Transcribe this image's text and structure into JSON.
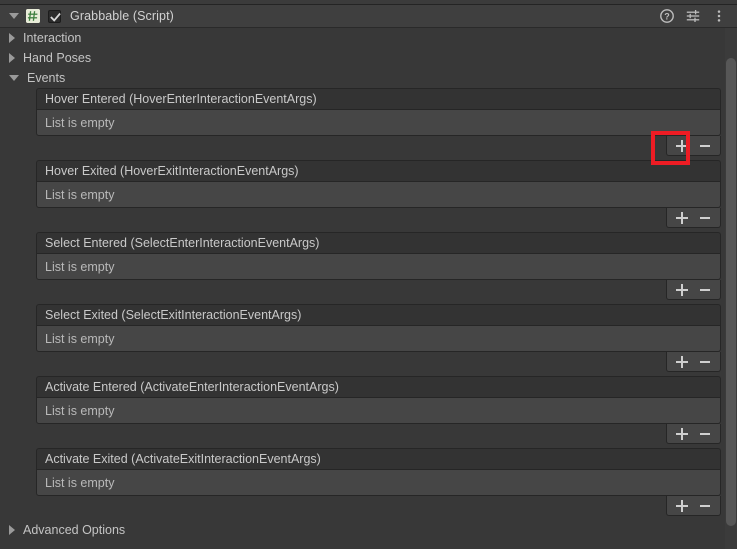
{
  "component": {
    "title": "Grabbable (Script)",
    "enabled": true,
    "expanded": true,
    "script_icon": "csharp-script-icon",
    "header_icons": [
      {
        "name": "help-icon",
        "glyph": "?"
      },
      {
        "name": "preset-icon",
        "glyph": "sliders"
      },
      {
        "name": "more-menu-icon",
        "glyph": "kebab"
      }
    ]
  },
  "properties": [
    {
      "label": "Interaction",
      "expanded": false
    },
    {
      "label": "Hand Poses",
      "expanded": false
    },
    {
      "label": "Events",
      "expanded": true
    }
  ],
  "events": [
    {
      "header": "Hover Entered (HoverEnterInteractionEventArgs)",
      "empty_text": "List is empty",
      "add_label": "+",
      "remove_label": "-",
      "highlighted": true
    },
    {
      "header": "Hover Exited (HoverExitInteractionEventArgs)",
      "empty_text": "List is empty",
      "add_label": "+",
      "remove_label": "-",
      "highlighted": false
    },
    {
      "header": "Select Entered (SelectEnterInteractionEventArgs)",
      "empty_text": "List is empty",
      "add_label": "+",
      "remove_label": "-",
      "highlighted": false
    },
    {
      "header": "Select Exited (SelectExitInteractionEventArgs)",
      "empty_text": "List is empty",
      "add_label": "+",
      "remove_label": "-",
      "highlighted": false
    },
    {
      "header": "Activate Entered (ActivateEnterInteractionEventArgs)",
      "empty_text": "List is empty",
      "add_label": "+",
      "remove_label": "-",
      "highlighted": false
    },
    {
      "header": "Activate Exited (ActivateExitInteractionEventArgs)",
      "empty_text": "List is empty",
      "add_label": "+",
      "remove_label": "-",
      "highlighted": false
    }
  ],
  "footer": {
    "advanced_options_label": "Advanced Options",
    "advanced_options_expanded": false
  },
  "colors": {
    "background": "#383838",
    "header_bar": "#3f3f3f",
    "event_header": "#333333",
    "event_body": "#464646",
    "border": "#262626",
    "text": "#c4c4c4",
    "highlight": "#ee1c24",
    "scrollbar_thumb": "#575757"
  }
}
